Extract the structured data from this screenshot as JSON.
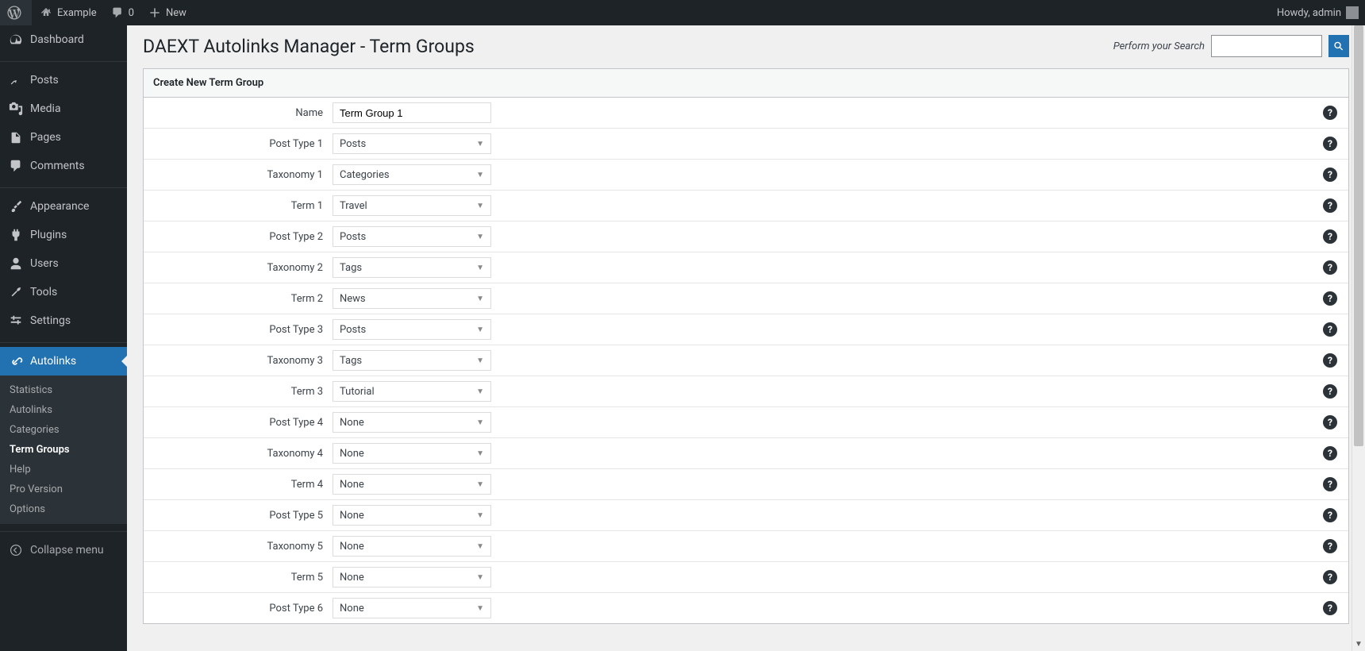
{
  "adminbar": {
    "site_name": "Example",
    "comments_count": "0",
    "new_label": "New",
    "howdy_label": "Howdy, admin"
  },
  "sidebar": {
    "main": [
      {
        "label": "Dashboard",
        "icon": "dashboard"
      },
      {
        "sep": true
      },
      {
        "label": "Posts",
        "icon": "pin"
      },
      {
        "label": "Media",
        "icon": "media"
      },
      {
        "label": "Pages",
        "icon": "pages"
      },
      {
        "label": "Comments",
        "icon": "comment"
      },
      {
        "sep": true
      },
      {
        "label": "Appearance",
        "icon": "brush"
      },
      {
        "label": "Plugins",
        "icon": "plug"
      },
      {
        "label": "Users",
        "icon": "user"
      },
      {
        "label": "Tools",
        "icon": "wrench"
      },
      {
        "label": "Settings",
        "icon": "sliders"
      },
      {
        "sep": true
      },
      {
        "label": "Autolinks",
        "icon": "link",
        "current": true
      }
    ],
    "submenu": [
      {
        "label": "Statistics"
      },
      {
        "label": "Autolinks"
      },
      {
        "label": "Categories"
      },
      {
        "label": "Term Groups",
        "current": true
      },
      {
        "label": "Help"
      },
      {
        "label": "Pro Version"
      },
      {
        "label": "Options"
      }
    ],
    "collapse_label": "Collapse menu"
  },
  "page": {
    "title": "DAEXT Autolinks Manager - Term Groups",
    "search_label": "Perform your Search"
  },
  "form": {
    "header": "Create New Term Group",
    "name_label": "Name",
    "name_value": "Term Group 1",
    "rows": [
      {
        "label": "Post Type 1",
        "value": "Posts"
      },
      {
        "label": "Taxonomy 1",
        "value": "Categories"
      },
      {
        "label": "Term 1",
        "value": "Travel"
      },
      {
        "label": "Post Type 2",
        "value": "Posts"
      },
      {
        "label": "Taxonomy 2",
        "value": "Tags"
      },
      {
        "label": "Term 2",
        "value": "News"
      },
      {
        "label": "Post Type 3",
        "value": "Posts"
      },
      {
        "label": "Taxonomy 3",
        "value": "Tags"
      },
      {
        "label": "Term 3",
        "value": "Tutorial"
      },
      {
        "label": "Post Type 4",
        "value": "None"
      },
      {
        "label": "Taxonomy 4",
        "value": "None"
      },
      {
        "label": "Term 4",
        "value": "None"
      },
      {
        "label": "Post Type 5",
        "value": "None"
      },
      {
        "label": "Taxonomy 5",
        "value": "None"
      },
      {
        "label": "Term 5",
        "value": "None"
      },
      {
        "label": "Post Type 6",
        "value": "None"
      }
    ]
  }
}
